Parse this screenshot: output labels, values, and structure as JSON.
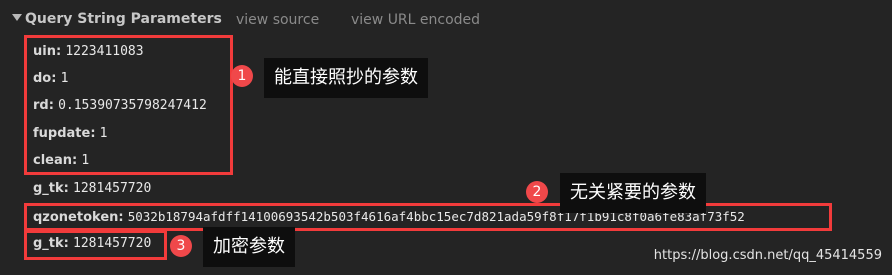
{
  "header": {
    "title": "Query String Parameters",
    "view_source": "view source",
    "view_url_encoded": "view URL encoded"
  },
  "params": [
    {
      "key": "uin:",
      "value": "1223411083"
    },
    {
      "key": "do:",
      "value": "1"
    },
    {
      "key": "rd:",
      "value": "0.15390735798247412"
    },
    {
      "key": "fupdate:",
      "value": "1"
    },
    {
      "key": "clean:",
      "value": "1"
    },
    {
      "key": "g_tk:",
      "value": "1281457720"
    },
    {
      "key": "qzonetoken:",
      "value": "5032b18794afdff14100693542b503f4616af4bbc15ec7d821ada59f8f17f1b91c8f0a6fe83af73f52"
    },
    {
      "key": "g_tk:",
      "value": "1281457720"
    }
  ],
  "annotations": [
    {
      "number": "1",
      "text": "能直接照抄的参数"
    },
    {
      "number": "2",
      "text": "无关紧要的参数"
    },
    {
      "number": "3",
      "text": "加密参数"
    }
  ],
  "watermark": "https://blog.csdn.net/qq_45414559",
  "colors": {
    "background": "#242424",
    "highlight_border": "#f23b3b",
    "badge": "#f0484a",
    "callout_bg": "#0e0e0e"
  }
}
